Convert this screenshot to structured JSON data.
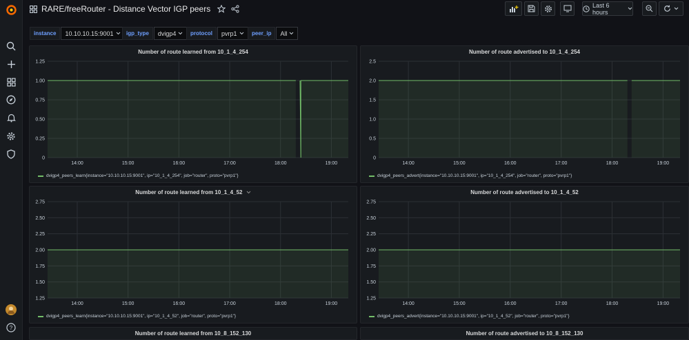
{
  "header": {
    "title": "RARE/freeRouter - Distance Vector IGP peers",
    "time_range": "Last 6 hours"
  },
  "variables": [
    {
      "label": "instance",
      "value": "10.10.10.15:9001"
    },
    {
      "label": "igp_type",
      "value": "dvigp4"
    },
    {
      "label": "protocol",
      "value": "pvrp1"
    },
    {
      "label": "peer_ip",
      "value": "All"
    }
  ],
  "colors": {
    "series": "#73bf69",
    "accent": "#6e9fff",
    "background": "#111217",
    "panel": "#181b1f"
  },
  "icons": [
    "grafana-logo",
    "search-icon",
    "plus-icon",
    "dashboards-icon",
    "explore-icon",
    "alert-icon",
    "gear-icon",
    "shield-icon",
    "avatar",
    "help-icon",
    "grid-icon",
    "star-icon",
    "share-icon",
    "add-panel-icon",
    "save-icon",
    "settings-icon",
    "tv-icon",
    "clock-icon",
    "zoom-out-icon",
    "refresh-icon",
    "chevron-down-icon"
  ],
  "panels": [
    {
      "title": "Number of route learned from 10_1_4_254",
      "legend": "dvigp4_peers_learn{instance=\"10.10.10.15:9001\", ip=\"10_1_4_254\", job=\"router\", proto=\"pvrp1\"}"
    },
    {
      "title": "Number of route advertised to 10_1_4_254",
      "legend": "dvigp4_peers_advert{instance=\"10.10.10.15:9001\", ip=\"10_1_4_254\", job=\"router\", proto=\"pvrp1\"}"
    },
    {
      "title": "Number of route learned from 10_1_4_52",
      "legend": "dvigp4_peers_learn{instance=\"10.10.10.15:9001\", ip=\"10_1_4_52\", job=\"router\", proto=\"pvrp1\"}"
    },
    {
      "title": "Number of route advertised to 10_1_4_52",
      "legend": "dvigp4_peers_advert{instance=\"10.10.10.15:9001\", ip=\"10_1_4_52\", job=\"router\", proto=\"pvrp1\"}"
    },
    {
      "title": "Number of route learned from 10_8_152_130"
    },
    {
      "title": "Number of route advertised to 10_8_152_130"
    }
  ],
  "chart_data": [
    {
      "type": "line",
      "title": "Number of route learned from 10_1_4_254",
      "x": [
        "13:25",
        "18:18",
        "18:22",
        "18:23",
        "18:24",
        "18:24",
        "19:20"
      ],
      "series": [
        {
          "name": "dvigp4_peers_learn{instance=\"10.10.10.15:9001\", ip=\"10_1_4_254\", job=\"router\", proto=\"pvrp1\"}",
          "values": [
            1,
            1,
            null,
            1,
            0,
            1,
            1
          ]
        }
      ],
      "x_ticks": [
        "14:00",
        "15:00",
        "16:00",
        "17:00",
        "18:00",
        "19:00"
      ],
      "y_ticks": [
        "0",
        "0.25",
        "0.50",
        "0.75",
        "1.00",
        "1.25"
      ],
      "ylim": [
        0,
        1.25
      ]
    },
    {
      "type": "line",
      "title": "Number of route advertised to 10_1_4_254",
      "x": [
        "13:25",
        "18:18",
        "18:22",
        "18:23",
        "19:20"
      ],
      "series": [
        {
          "name": "dvigp4_peers_advert{instance=\"10.10.10.15:9001\", ip=\"10_1_4_254\", job=\"router\", proto=\"pvrp1\"}",
          "values": [
            2,
            2,
            null,
            2,
            2
          ]
        }
      ],
      "x_ticks": [
        "14:00",
        "15:00",
        "16:00",
        "17:00",
        "18:00",
        "19:00"
      ],
      "y_ticks": [
        "0",
        "0.5",
        "1.0",
        "1.5",
        "2.0",
        "2.5"
      ],
      "ylim": [
        0,
        2.5
      ]
    },
    {
      "type": "line",
      "title": "Number of route learned from 10_1_4_52",
      "x": [
        "13:25",
        "19:20"
      ],
      "series": [
        {
          "name": "dvigp4_peers_learn{instance=\"10.10.10.15:9001\", ip=\"10_1_4_52\", job=\"router\", proto=\"pvrp1\"}",
          "values": [
            2,
            2
          ]
        }
      ],
      "x_ticks": [
        "14:00",
        "15:00",
        "16:00",
        "17:00",
        "18:00",
        "19:00"
      ],
      "y_ticks": [
        "1.25",
        "1.50",
        "1.75",
        "2.00",
        "2.25",
        "2.50",
        "2.75"
      ],
      "ylim": [
        1.25,
        2.75
      ]
    },
    {
      "type": "line",
      "title": "Number of route advertised to 10_1_4_52",
      "x": [
        "13:25",
        "19:20"
      ],
      "series": [
        {
          "name": "dvigp4_peers_advert{instance=\"10.10.10.15:9001\", ip=\"10_1_4_52\", job=\"router\", proto=\"pvrp1\"}",
          "values": [
            2,
            2
          ]
        }
      ],
      "x_ticks": [
        "14:00",
        "15:00",
        "16:00",
        "17:00",
        "18:00",
        "19:00"
      ],
      "y_ticks": [
        "1.25",
        "1.50",
        "1.75",
        "2.00",
        "2.25",
        "2.50",
        "2.75"
      ],
      "ylim": [
        1.25,
        2.75
      ]
    }
  ]
}
